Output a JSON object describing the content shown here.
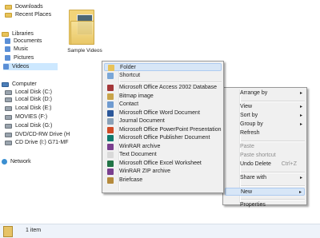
{
  "nav": {
    "items": [
      {
        "label": "Downloads",
        "icon": "folder-icon",
        "indent": true,
        "selected": false
      },
      {
        "label": "Recent Places",
        "icon": "recent-places-icon",
        "indent": true,
        "selected": false
      },
      {
        "label": "Libraries",
        "icon": "libraries-icon",
        "indent": false,
        "selected": false
      },
      {
        "label": "Documents",
        "icon": "documents-icon",
        "indent": true,
        "selected": false
      },
      {
        "label": "Music",
        "icon": "music-icon",
        "indent": true,
        "selected": false
      },
      {
        "label": "Pictures",
        "icon": "pictures-icon",
        "indent": true,
        "selected": false
      },
      {
        "label": "Videos",
        "icon": "videos-icon",
        "indent": true,
        "selected": true
      },
      {
        "label": "Computer",
        "icon": "computer-icon",
        "indent": false,
        "selected": false
      },
      {
        "label": "Local Disk (C:)",
        "icon": "disk-icon",
        "indent": true,
        "selected": false
      },
      {
        "label": "Local Disk (D:)",
        "icon": "disk-icon",
        "indent": true,
        "selected": false
      },
      {
        "label": "Local Disk (E:)",
        "icon": "disk-icon",
        "indent": true,
        "selected": false
      },
      {
        "label": "MOVIES (F:)",
        "icon": "disk-icon",
        "indent": true,
        "selected": false
      },
      {
        "label": "Local Disk (G:)",
        "icon": "disk-icon",
        "indent": true,
        "selected": false
      },
      {
        "label": "DVD/CD-RW Drive (H",
        "icon": "dvd-drive-icon",
        "indent": true,
        "selected": false
      },
      {
        "label": "CD Drive (I:) G71-MF",
        "icon": "cd-drive-icon",
        "indent": true,
        "selected": false
      },
      {
        "label": "Network",
        "icon": "network-icon",
        "indent": false,
        "selected": false
      }
    ]
  },
  "content": {
    "folder_label": "Sample Videos"
  },
  "context_menu": {
    "items": [
      {
        "kind": "item",
        "label": "Arrange by",
        "arrow": "▸",
        "disabled": false,
        "highlight": false
      },
      {
        "kind": "sep"
      },
      {
        "kind": "item",
        "label": "View",
        "arrow": "▸",
        "disabled": false,
        "highlight": false
      },
      {
        "kind": "item",
        "label": "Sort by",
        "arrow": "▸",
        "disabled": false,
        "highlight": false
      },
      {
        "kind": "item",
        "label": "Group by",
        "arrow": "▸",
        "disabled": false,
        "highlight": false
      },
      {
        "kind": "item",
        "label": "Refresh",
        "disabled": false,
        "highlight": false
      },
      {
        "kind": "sep"
      },
      {
        "kind": "item",
        "label": "Paste",
        "disabled": true,
        "highlight": false
      },
      {
        "kind": "item",
        "label": "Paste shortcut",
        "disabled": true,
        "highlight": false
      },
      {
        "kind": "item",
        "label": "Undo Delete",
        "shortcut": "Ctrl+Z",
        "disabled": false,
        "highlight": false
      },
      {
        "kind": "sep"
      },
      {
        "kind": "item",
        "label": "Share with",
        "arrow": "▸",
        "disabled": false,
        "highlight": false
      },
      {
        "kind": "sep"
      },
      {
        "kind": "item",
        "label": "New",
        "arrow": "▸",
        "disabled": false,
        "highlight": true
      },
      {
        "kind": "sep"
      },
      {
        "kind": "item",
        "label": "Properties",
        "disabled": false,
        "highlight": false
      }
    ]
  },
  "new_submenu": {
    "items": [
      {
        "kind": "item",
        "label": "Folder",
        "icon": "folder-icon",
        "color": "#e8c35a",
        "highlight": true
      },
      {
        "kind": "item",
        "label": "Shortcut",
        "icon": "shortcut-icon",
        "color": "#7aa7d8",
        "highlight": false
      },
      {
        "kind": "sep"
      },
      {
        "kind": "item",
        "label": "Microsoft Office Access 2002 Database",
        "icon": "access-icon",
        "color": "#a4373a",
        "highlight": false
      },
      {
        "kind": "item",
        "label": "Bitmap image",
        "icon": "bitmap-icon",
        "color": "#c9a44a",
        "highlight": false
      },
      {
        "kind": "item",
        "label": "Contact",
        "icon": "contact-icon",
        "color": "#6f9bd1",
        "highlight": false
      },
      {
        "kind": "item",
        "label": "Microsoft Office Word Document",
        "icon": "word-icon",
        "color": "#2b579a",
        "highlight": false
      },
      {
        "kind": "item",
        "label": "Journal Document",
        "icon": "journal-icon",
        "color": "#8aa1b8",
        "highlight": false
      },
      {
        "kind": "item",
        "label": "Microsoft Office PowerPoint Presentation",
        "icon": "powerpoint-icon",
        "color": "#d04a26",
        "highlight": false
      },
      {
        "kind": "item",
        "label": "Microsoft Office Publisher Document",
        "icon": "publisher-icon",
        "color": "#0f7a6e",
        "highlight": false
      },
      {
        "kind": "item",
        "label": "WinRAR archive",
        "icon": "winrar-icon",
        "color": "#7a3f8f",
        "highlight": false
      },
      {
        "kind": "item",
        "label": "Text Document",
        "icon": "text-document-icon",
        "color": "#d9d9d9",
        "highlight": false
      },
      {
        "kind": "item",
        "label": "Microsoft Office Excel Worksheet",
        "icon": "excel-icon",
        "color": "#217346",
        "highlight": false
      },
      {
        "kind": "item",
        "label": "WinRAR ZIP archive",
        "icon": "winrar-zip-icon",
        "color": "#7a3f8f",
        "highlight": false
      },
      {
        "kind": "item",
        "label": "Briefcase",
        "icon": "briefcase-icon",
        "color": "#b58a3c",
        "highlight": false
      }
    ]
  },
  "status": {
    "count_text": "1 item"
  }
}
